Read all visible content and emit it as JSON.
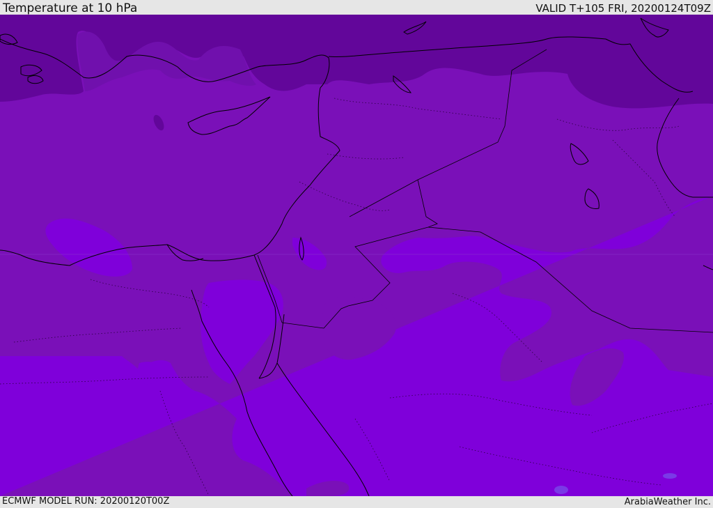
{
  "header": {
    "title": "Temperature at 10 hPa",
    "valid_time": "VALID T+105 FRI, 20200124T09Z"
  },
  "footer": {
    "model_run": "ECMWF MODEL RUN: 20200120T00Z",
    "credit": "ArabiaWeather Inc."
  },
  "map": {
    "field": "temperature",
    "level": "10 hPa",
    "colors": {
      "coldest": "#62069a",
      "mid": "#7a10b8",
      "warm": "#7f00da",
      "warmest_spot": "#7a3ae6",
      "background": "#7d14b8",
      "coastline": "#000000"
    }
  }
}
